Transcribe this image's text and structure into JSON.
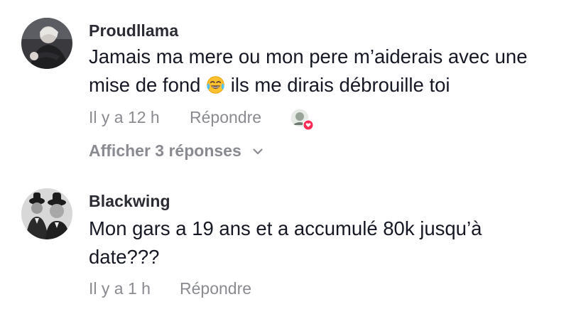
{
  "comments": [
    {
      "username": "Proudllama",
      "text_line1": "Jamais ma mere ou mon pere m’aiderais avec une",
      "text_line2_before": "mise de fond",
      "text_line2_after": "ils me dirais débrouille toi",
      "emoji": "face-with-tears-of-joy",
      "time": "Il y a 12 h",
      "reply_label": "Répondre",
      "show_replies_label": "Afficher 3 réponses"
    },
    {
      "username": "Blackwing",
      "text_line1": "Mon gars a 19 ans et a accumulé 80k jusqu’à",
      "text_line2": "date???",
      "time": "Il y a 1 h",
      "reply_label": "Répondre"
    }
  ],
  "colors": {
    "text": "#161823",
    "muted": "#8a8b91",
    "username": "#2b2b33",
    "like_heart": "#fe2c55"
  }
}
